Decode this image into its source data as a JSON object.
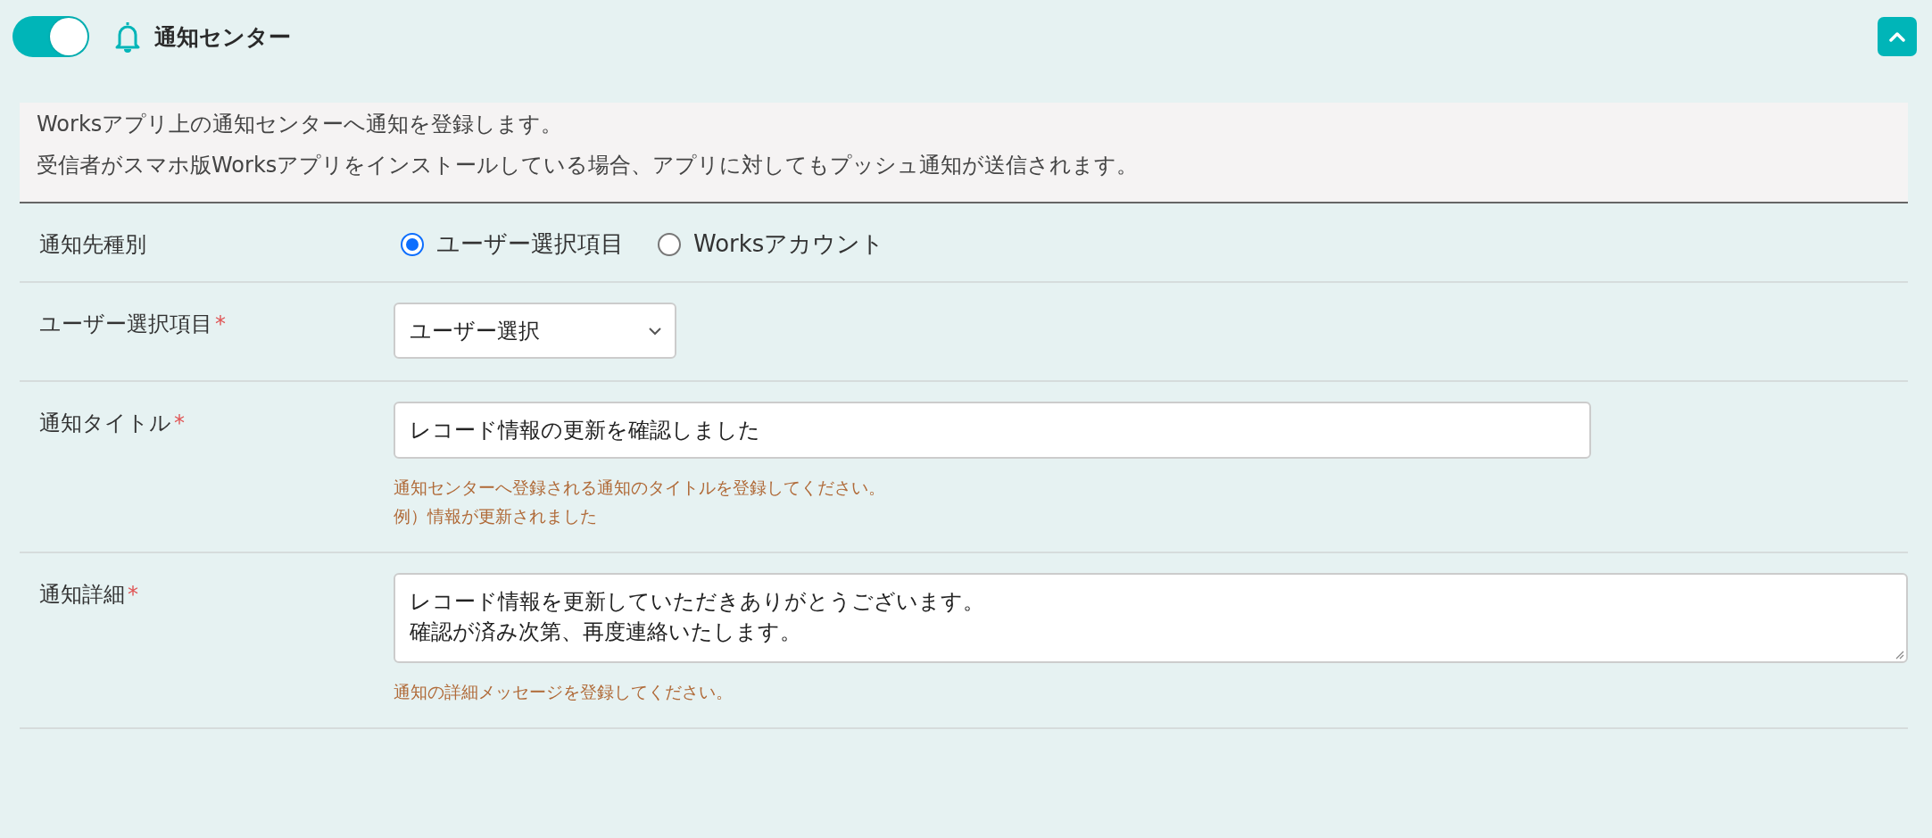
{
  "header": {
    "enabled": true,
    "title": "通知センター",
    "expanded": true
  },
  "description": [
    "Worksアプリ上の通知センターへ通知を登録します。",
    "受信者がスマホ版Worksアプリをインストールしている場合、アプリに対してもプッシュ通知が送信されます。"
  ],
  "fields": [
    {
      "kind": "radio",
      "label": "通知先種別",
      "options": [
        {
          "label": "ユーザー選択項目",
          "selected": true
        },
        {
          "label": "Worksアカウント",
          "selected": false
        }
      ]
    },
    {
      "kind": "select",
      "label": "ユーザー選択項目",
      "required_mark": "*",
      "value": "ユーザー選択"
    },
    {
      "kind": "text",
      "label": "通知タイトル",
      "required_mark": "*",
      "value": "レコード情報の更新を確認しました",
      "hints": [
        "通知センターへ登録される通知のタイトルを登録してください。",
        "例）情報が更新されました"
      ]
    },
    {
      "kind": "textarea",
      "label": "通知詳細",
      "required_mark": "*",
      "lines": [
        "レコード情報を更新していただきありがとうございます。",
        "確認が済み次第、再度連絡いたします。"
      ],
      "hints": [
        "通知の詳細メッセージを登録してください。"
      ]
    }
  ]
}
